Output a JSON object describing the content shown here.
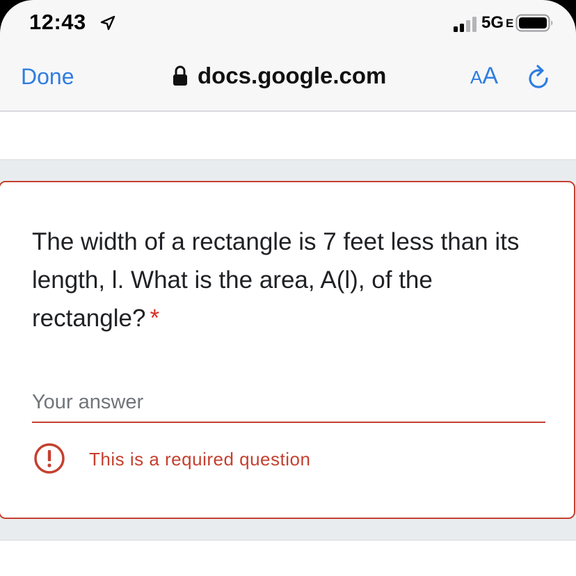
{
  "status_bar": {
    "time": "12:43",
    "network": "5G",
    "network_sub": "E",
    "icons": [
      "location-arrow-icon",
      "signal-icon",
      "battery-icon"
    ]
  },
  "browser": {
    "done_label": "Done",
    "url": "docs.google.com",
    "text_size_small": "A",
    "text_size_big": "A",
    "icons": [
      "lock-icon",
      "reload-icon"
    ],
    "accent_color": "#2f7de1"
  },
  "form": {
    "question": "The width of a rectangle is 7 feet less than its length, l. What is the area, A(l), of the rectangle?",
    "required_marker": "*",
    "answer_placeholder": "Your answer",
    "answer_value": "",
    "error_message": "This is a required question",
    "error_icon": "error-exclamation-icon",
    "error_color": "#c5402f"
  }
}
